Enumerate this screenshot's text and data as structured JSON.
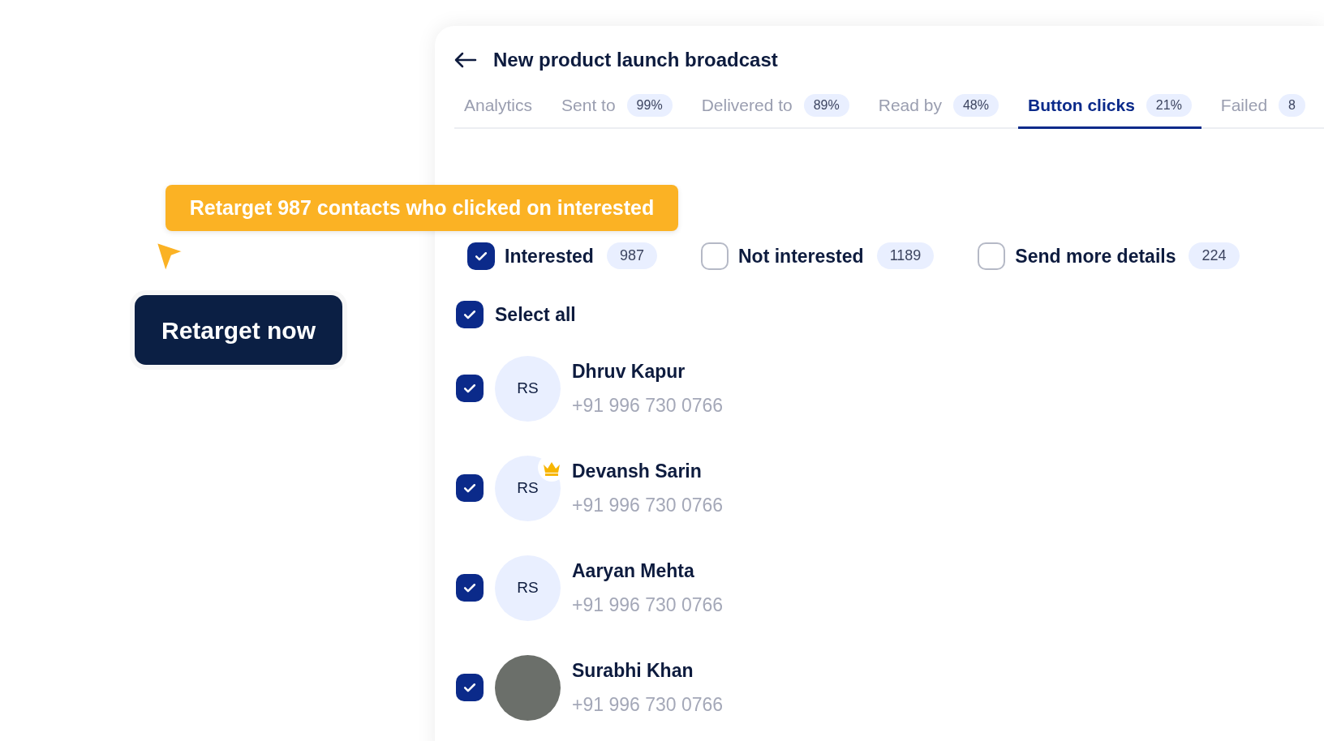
{
  "tooltip": {
    "text": "Retarget 987 contacts who clicked on interested"
  },
  "retarget_button": {
    "label": "Retarget now"
  },
  "header": {
    "title": "New product launch broadcast"
  },
  "tabs": [
    {
      "label": "Analytics",
      "selected": false
    },
    {
      "label": "Sent to",
      "count": "99%",
      "selected": false
    },
    {
      "label": "Delivered to",
      "count": "89%",
      "selected": false
    },
    {
      "label": "Read by",
      "count": "48%",
      "selected": false
    },
    {
      "label": "Button clicks",
      "count": "21%",
      "selected": true
    },
    {
      "label": "Failed",
      "count": "8",
      "selected": false
    }
  ],
  "filters": [
    {
      "label": "Interested",
      "count": "987",
      "checked": true
    },
    {
      "label": "Not interested",
      "count": "1189",
      "checked": false
    },
    {
      "label": "Send more details",
      "count": "224",
      "checked": false
    }
  ],
  "select_all": {
    "label": "Select all",
    "checked": true
  },
  "contacts": [
    {
      "name": "Dhruv Kapur",
      "phone": "+91 996 730 0766",
      "checked": true,
      "kind": "initials",
      "initials": "RS",
      "premium": false
    },
    {
      "name": "Devansh Sarin",
      "phone": "+91 996 730 0766",
      "checked": true,
      "kind": "initials",
      "initials": "RS",
      "premium": true
    },
    {
      "name": "Aaryan Mehta",
      "phone": "+91 996 730 0766",
      "checked": true,
      "kind": "initials",
      "initials": "RS",
      "premium": false
    },
    {
      "name": "Surabhi Khan",
      "phone": "+91 996 730 0766",
      "checked": true,
      "kind": "photo",
      "premium": false
    }
  ]
}
